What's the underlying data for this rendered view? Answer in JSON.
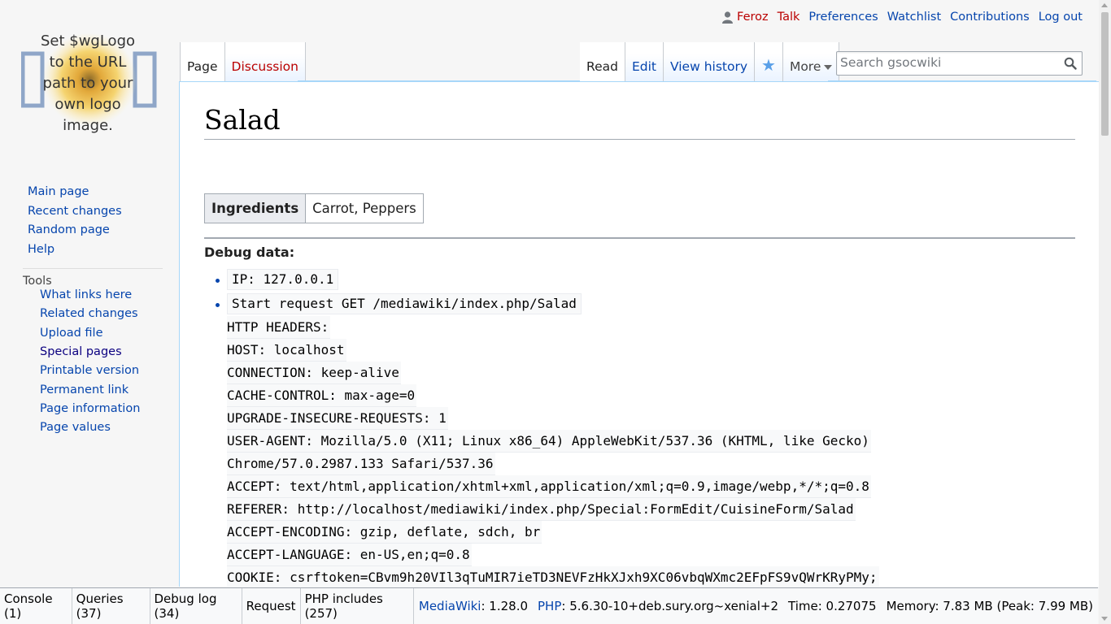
{
  "personal": {
    "user": "Feroz",
    "talk": "Talk",
    "preferences": "Preferences",
    "watchlist": "Watchlist",
    "contributions": "Contributions",
    "logout": "Log out"
  },
  "logo": {
    "lines": [
      "Set $wgLogo",
      "to the URL",
      "path to your",
      "own logo",
      "image."
    ]
  },
  "nav": {
    "main": [
      "Main page",
      "Recent changes",
      "Random page",
      "Help"
    ],
    "tools_heading": "Tools",
    "tools": [
      "What links here",
      "Related changes",
      "Upload file",
      "Special pages",
      "Printable version",
      "Permanent link",
      "Page information",
      "Page values"
    ]
  },
  "tabs": {
    "page": "Page",
    "discussion": "Discussion",
    "read": "Read",
    "edit": "Edit",
    "history": "View history",
    "more": "More"
  },
  "search": {
    "placeholder": "Search gsocwiki"
  },
  "page": {
    "title": "Salad",
    "infobox": {
      "key": "Ingredients",
      "value": "Carrot, Peppers"
    },
    "debug_heading": "Debug data:",
    "debug_ip": "IP: 127.0.0.1",
    "debug_request": "Start request GET /mediawiki/index.php/Salad",
    "debug_lines": [
      "HTTP HEADERS:",
      "HOST: localhost",
      "CONNECTION: keep-alive",
      "CACHE-CONTROL: max-age=0",
      "UPGRADE-INSECURE-REQUESTS: 1",
      "USER-AGENT: Mozilla/5.0 (X11; Linux x86_64) AppleWebKit/537.36 (KHTML, like Gecko)",
      "Chrome/57.0.2987.133 Safari/537.36",
      "ACCEPT: text/html,application/xhtml+xml,application/xml;q=0.9,image/webp,*/*;q=0.8",
      "REFERER: http://localhost/mediawiki/index.php/Special:FormEdit/CuisineForm/Salad",
      "ACCEPT-ENCODING: gzip, deflate, sdch, br",
      "ACCEPT-LANGUAGE: en-US,en;q=0.8",
      "COOKIE: csrftoken=CBvm9h20VIl3qTuMIR7ieTD3NEVFzHkXJxh9XC06vbqWXmc2EFpFS9vQWrKRyPMy;"
    ]
  },
  "toolbar": {
    "console": "Console (1)",
    "queries": "Queries (37)",
    "debuglog": "Debug log (34)",
    "request": "Request",
    "includes": "PHP includes (257)",
    "mw_label": "MediaWiki",
    "mw_version": ": 1.28.0",
    "php_label": "PHP",
    "php_version": ": 5.6.30-10+deb.sury.org~xenial+2",
    "time": "Time: 0.27075",
    "memory": "Memory: 7.83 MB (Peak: 7.99 MB)"
  }
}
